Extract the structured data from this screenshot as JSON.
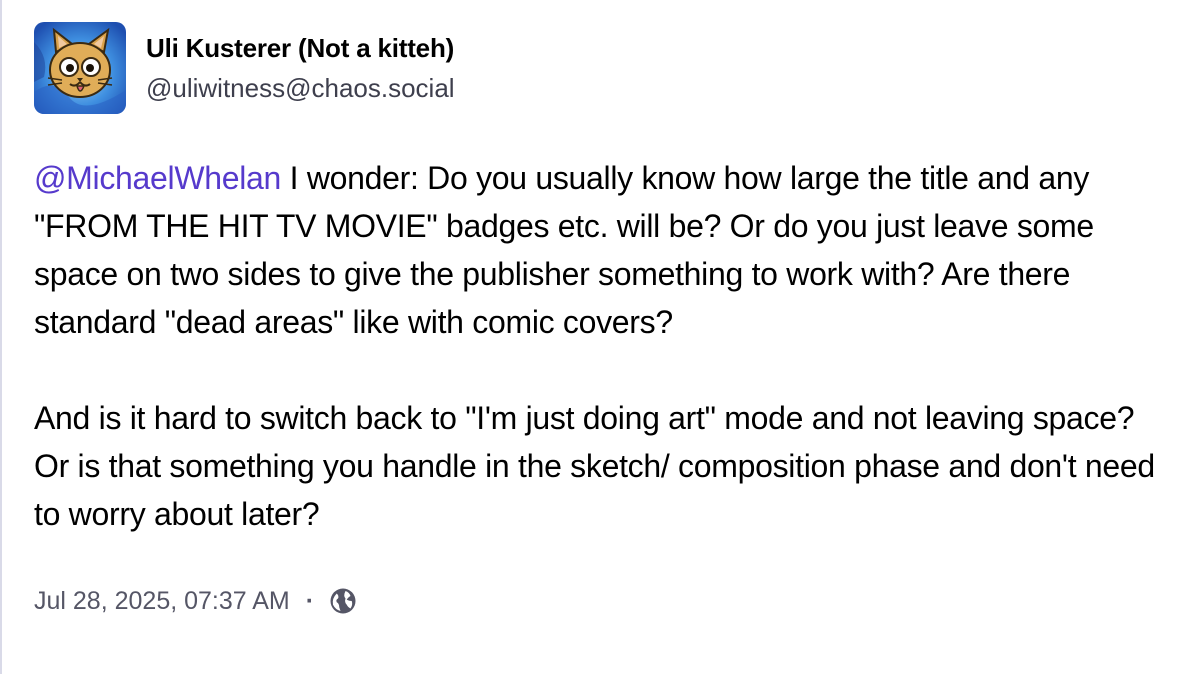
{
  "author": {
    "display_name": "Uli Kusterer (Not a kitteh)",
    "handle": "@uliwitness@chaos.social",
    "avatar_icon": "cat-avatar-icon"
  },
  "post": {
    "mention": "@MichaelWhelan",
    "paragraph1_rest": " I wonder: Do you usually know how large the title and any \"FROM THE HIT TV MOVIE\" badges etc. will be? Or do you just leave some space on two sides to give the publisher something to work with? Are there standard \"dead areas\" like with comic covers?",
    "paragraph2": "And is it hard to switch back to \"I'm just doing art\" mode and not leaving space? Or is that something you handle in the sketch/ composition phase and don't need to worry about later?"
  },
  "meta": {
    "timestamp": "Jul 28, 2025, 07:37 AM",
    "separator": "·",
    "visibility_icon": "globe-icon"
  },
  "colors": {
    "mention": "#563acc",
    "meta_text": "#555666",
    "handle_text": "#3e3f4d"
  }
}
